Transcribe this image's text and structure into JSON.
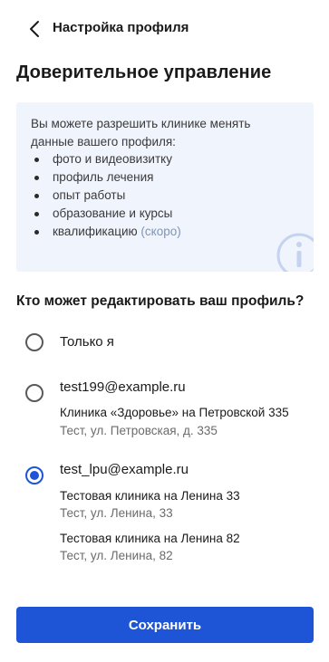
{
  "header": {
    "title": "Настройка профиля"
  },
  "page_title": "Доверительное управление",
  "info": {
    "text": "Вы можете разрешить клинике менять данные вашего профиля:",
    "items": [
      "фото и видеовизитку",
      "профиль лечения",
      "опыт работы",
      "образование и курсы",
      "квалификацию"
    ],
    "soon_label": "(скоро)"
  },
  "question": "Кто может редактировать ваш профиль?",
  "options": [
    {
      "label": "Только я",
      "selected": false,
      "clinics": []
    },
    {
      "label": "test199@example.ru",
      "selected": false,
      "clinics": [
        {
          "name": "Клиника «Здоровье» на Петровской 335",
          "address": "Тест, ул. Петровская, д. 335"
        }
      ]
    },
    {
      "label": "test_lpu@example.ru",
      "selected": true,
      "clinics": [
        {
          "name": "Тестовая клиника на Ленина 33",
          "address": "Тест, ул. Ленина, 33"
        },
        {
          "name": "Тестовая клиника на Ленина 82",
          "address": "Тест, ул. Ленина, 82"
        }
      ]
    }
  ],
  "save_label": "Сохранить",
  "colors": {
    "accent": "#1e55d6",
    "info_bg": "#f0f4fd",
    "soon_text": "#7f94b8"
  }
}
